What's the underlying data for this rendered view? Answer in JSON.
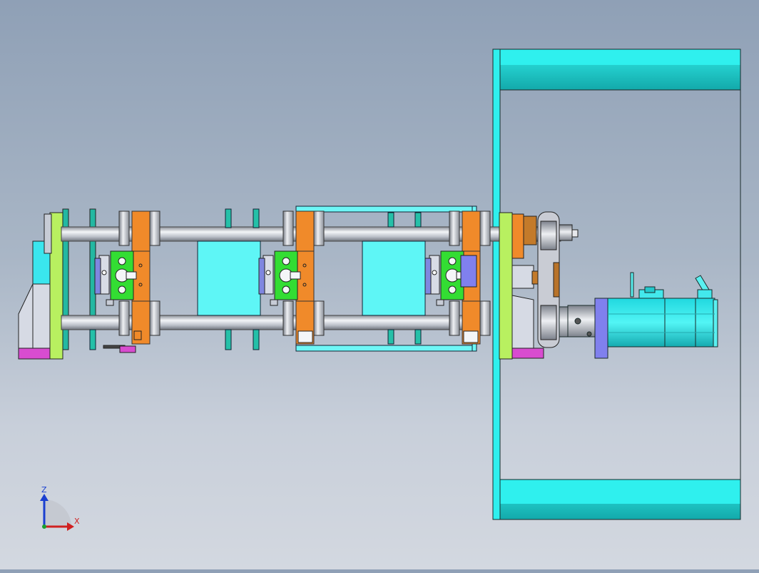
{
  "viewport": {
    "background_top": "#8fa0b6",
    "background_bottom": "#d3d8e0"
  },
  "triad": {
    "z_label": "Z",
    "x_label": "X",
    "z_color": "#1a3fd0",
    "x_color": "#d02020",
    "y_color": "#1aa030"
  },
  "colors": {
    "cyan": "#33f0f0",
    "cyan_dark": "#17b9bd",
    "orange": "#f08a2a",
    "green": "#33dd33",
    "light_green": "#b8f060",
    "magenta": "#d84cd0",
    "violet": "#8080ee",
    "steel": "#c7ccd6",
    "gray_plate": "#d8dce6"
  }
}
